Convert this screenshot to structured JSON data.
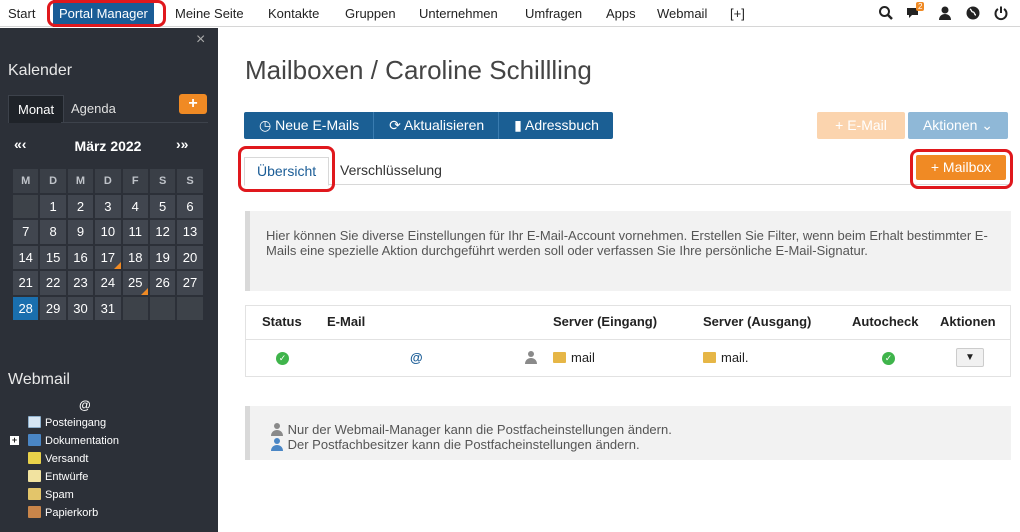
{
  "topnav": {
    "items": [
      "Start",
      "Portal Manager",
      "Meine Seite",
      "Kontakte",
      "Gruppen",
      "Unternehmen",
      "Umfragen",
      "Apps",
      "Webmail",
      "[+]"
    ],
    "notification_count": "2",
    "icons": [
      "search-icon",
      "chat-icon",
      "user-icon",
      "globe-icon",
      "power-icon"
    ]
  },
  "sidebar": {
    "close": "×",
    "calendar_title": "Kalender",
    "tabs": [
      "Monat",
      "Agenda"
    ],
    "add": "+",
    "nav_prev": "«‹",
    "nav_next": "›»",
    "month": "März 2022",
    "weekdays": [
      "M",
      "D",
      "M",
      "D",
      "F",
      "S",
      "S"
    ],
    "weeks": [
      [
        "",
        "",
        "1",
        "2",
        "3",
        "4",
        "5",
        "6"
      ],
      [
        "7",
        "8",
        "9",
        "10",
        "11",
        "12",
        "13"
      ],
      [
        "14",
        "15",
        "16",
        "17",
        "18",
        "19",
        "20"
      ],
      [
        "21",
        "22",
        "23",
        "24",
        "25",
        "26",
        "27"
      ],
      [
        "28",
        "29",
        "30",
        "31",
        "",
        "",
        ""
      ]
    ],
    "webmail_title": "Webmail",
    "account_symbol": "@",
    "folders": [
      "Posteingang",
      "Dokumentation",
      "Versandt",
      "Entwürfe",
      "Spam",
      "Papierkorb"
    ],
    "expand_symbol": "+",
    "accent": "#f08a24"
  },
  "main": {
    "title": "Mailboxen / Caroline Schillling",
    "buttons": {
      "new_mails": "Neue E-Mails",
      "refresh": "Aktualisieren",
      "addressbook": "Adressbuch",
      "email": "+ E-Mail",
      "actions": "Aktionen",
      "mailbox": "+ Mailbox"
    },
    "tabs": [
      "Übersicht",
      "Verschlüsselung"
    ],
    "info_text": "Hier können Sie diverse Einstellungen für Ihr E-Mail-Account vornehmen. Erstellen Sie Filter, wenn beim Erhalt bestimmter E-Mails eine spezielle Aktion durchgeführt werden soll oder verfassen Sie Ihre persönliche E-Mail-Signatur.",
    "table": {
      "headers": [
        "Status",
        "E-Mail",
        "Server (Eingang)",
        "Server (Ausgang)",
        "Autocheck",
        "Aktionen"
      ],
      "row": {
        "email_symbol": "@",
        "server_in": "mail",
        "server_out": "mail."
      }
    },
    "legend": [
      "Nur der Webmail-Manager kann die Postfacheinstellungen ändern.",
      "Der Postfachbesitzer kann die Postfacheinstellungen ändern."
    ]
  }
}
